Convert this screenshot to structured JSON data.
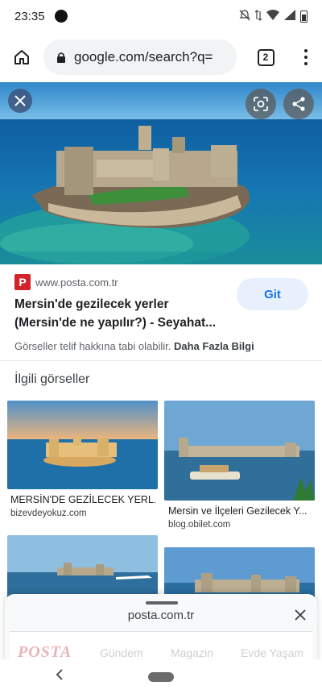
{
  "status_bar": {
    "time": "23:35"
  },
  "browser": {
    "url": "google.com/search?q=",
    "tab_count": "2"
  },
  "result": {
    "source_logo_letter": "P",
    "source_domain": "www.posta.com.tr",
    "title": "Mersin'de gezilecek yerler (Mersin'de ne yapılır?) - Seyahat...",
    "visit_button": "Git",
    "copyright_text": "Görseller telif hakkına tabi olabilir.",
    "copyright_link": "Daha Fazla Bilgi"
  },
  "related": {
    "heading": "İlgili görseller",
    "items": [
      {
        "caption": "MERSİN'DE GEZİLECEK YERL...",
        "domain": "bizevdeyokuz.com"
      },
      {
        "caption": "Mersin ve İlçeleri Gezilecek Y...",
        "domain": "blog.obilet.com"
      }
    ]
  },
  "bottom_sheet": {
    "title": "posta.com.tr",
    "logo": "POSTA",
    "nav": [
      "Gündem",
      "Magazin",
      "Evde Yaşam"
    ]
  },
  "icons": {
    "home": "home-icon",
    "lock": "lock-icon",
    "close": "close-icon",
    "lens": "lens-icon",
    "share": "share-icon",
    "menu": "more-vert-icon",
    "back": "back-icon"
  },
  "colors": {
    "accent_blue": "#1a73e8",
    "button_bg": "#e8f0fe",
    "posta_red": "#d3222a"
  }
}
